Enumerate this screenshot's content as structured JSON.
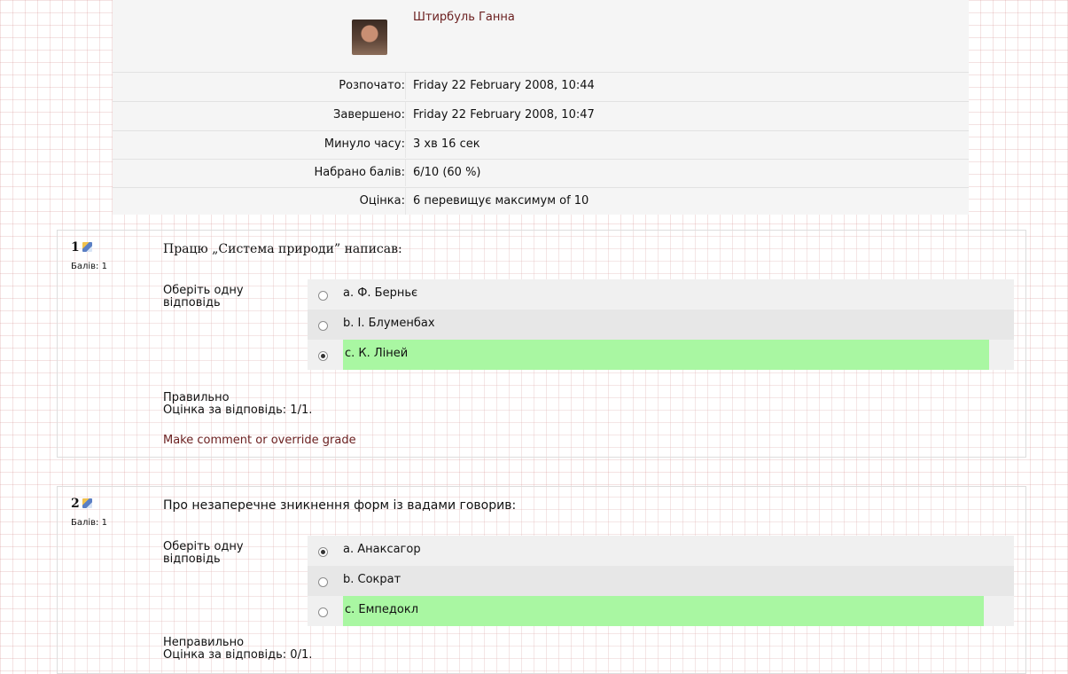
{
  "summary": {
    "user_name": "Штирбуль Ганна",
    "rows": [
      {
        "label": "Розпочато:",
        "value": "Friday 22 February 2008, 10:44"
      },
      {
        "label": "Завершено:",
        "value": "Friday 22 February 2008, 10:47"
      },
      {
        "label": "Минуло часу:",
        "value": "3 хв 16 сек"
      },
      {
        "label": "Набрано балів:",
        "value": "6/10 (60 %)"
      },
      {
        "label": "Оцінка:",
        "value": "6 перевищує максимум of 10"
      }
    ]
  },
  "questions": [
    {
      "number": "1",
      "marks": "Балів: 1",
      "text": "Працю „Система природи” написав:",
      "prompt": "Оберіть одну відповідь",
      "answers": [
        {
          "label": "a. Ф. Берньє",
          "selected": false,
          "correct": false
        },
        {
          "label": "b. І. Блуменбах",
          "selected": false,
          "correct": false
        },
        {
          "label": "c. К. Ліней",
          "selected": true,
          "correct": true
        }
      ],
      "result": "Правильно",
      "grade": "Оцінка за відповідь: 1/1.",
      "comment_link": "Make comment or override grade"
    },
    {
      "number": "2",
      "marks": "Балів: 1",
      "text": "Про незаперечне зникнення форм із вадами говорив:",
      "prompt": "Оберіть одну відповідь",
      "answers": [
        {
          "label": "a. Анаксагор",
          "selected": true,
          "correct": false
        },
        {
          "label": "b. Сократ",
          "selected": false,
          "correct": false
        },
        {
          "label": "c. Емпедокл",
          "selected": false,
          "correct": true
        }
      ],
      "result": "Неправильно",
      "grade": "Оцінка за відповідь: 0/1."
    }
  ],
  "colors": {
    "correct_highlight": "#a9f7a2",
    "link": "#6b2020"
  }
}
